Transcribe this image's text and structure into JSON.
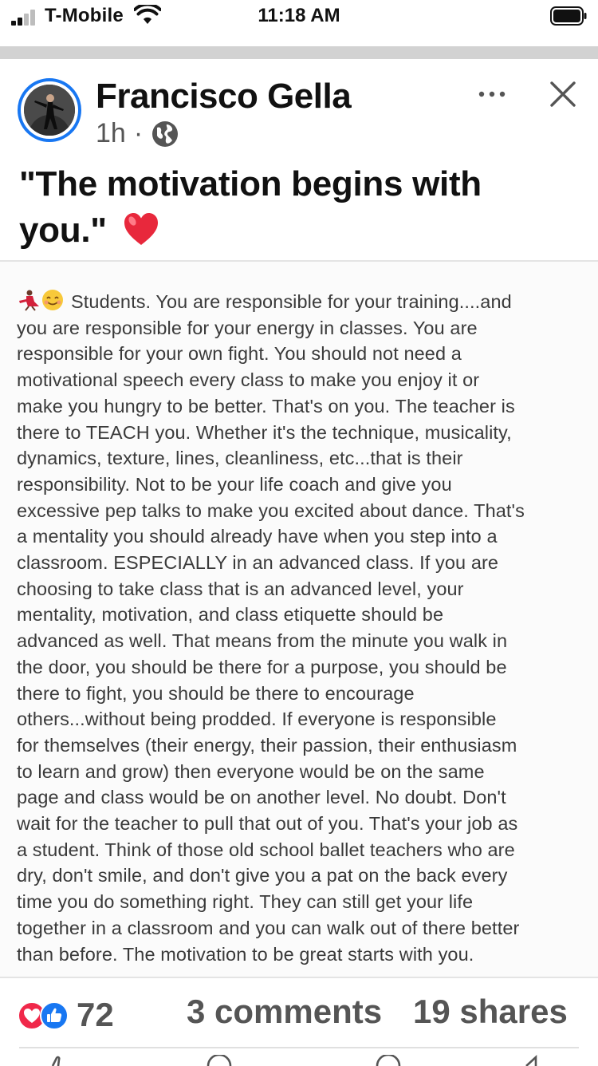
{
  "status_bar": {
    "carrier": "T-Mobile",
    "time": "11:18 AM"
  },
  "post": {
    "author": "Francisco Gella",
    "time_ago": "1h",
    "separator": "·",
    "audience_icon": "globe-icon",
    "caption": "\"The motivation begins with you.\"",
    "caption_emoji": "red-heart-icon",
    "body_emojis": [
      "dancer-icon",
      "smiling-face-icon"
    ],
    "body_lines": [
      "Students. You are responsible for your training....and",
      "you are responsible for your energy in classes. You are",
      "responsible for your own fight. You should not need a",
      "motivational speech every class to make you enjoy it or",
      "make you hungry to be better. That's on you. The teacher is",
      "there to TEACH you. Whether it's the technique, musicality,",
      "dynamics, texture, lines, cleanliness, etc...that is their",
      "responsibility. Not to be your life coach and give you",
      "excessive pep talks to make you excited about dance. That's",
      "a mentality you should already have when you step into a",
      "classroom. ESPECIALLY in an advanced class. If you are",
      "choosing to take class that is an advanced level, your",
      "mentality, motivation, and class etiquette should be",
      "advanced as well. That means from the minute you walk in",
      "the door, you should be there for a purpose, you should be",
      "there to fight, you should be there to encourage",
      "others...without being prodded. If everyone is responsible",
      "for themselves (their energy, their passion, their enthusiasm",
      "to learn and grow) then everyone would be on the same",
      "page and class would be on another level. No doubt. Don't",
      "wait for the teacher to pull that out of you. That's your job as",
      "a student. Think of those old school ballet teachers who are",
      "dry, don't smile, and don't give you a pat on the back every",
      "time you do something right. They can still get your life",
      "together in a classroom and you can walk out of there better",
      "than before. The motivation to be great starts with you."
    ]
  },
  "engagement": {
    "reaction_icons": [
      "love-reaction-icon",
      "like-reaction-icon"
    ],
    "reaction_count": "72",
    "comments": "3 comments",
    "shares": "19 shares"
  },
  "colors": {
    "facebook_blue": "#1877f2",
    "love_red": "#f0284a",
    "muted_text": "#555555"
  }
}
